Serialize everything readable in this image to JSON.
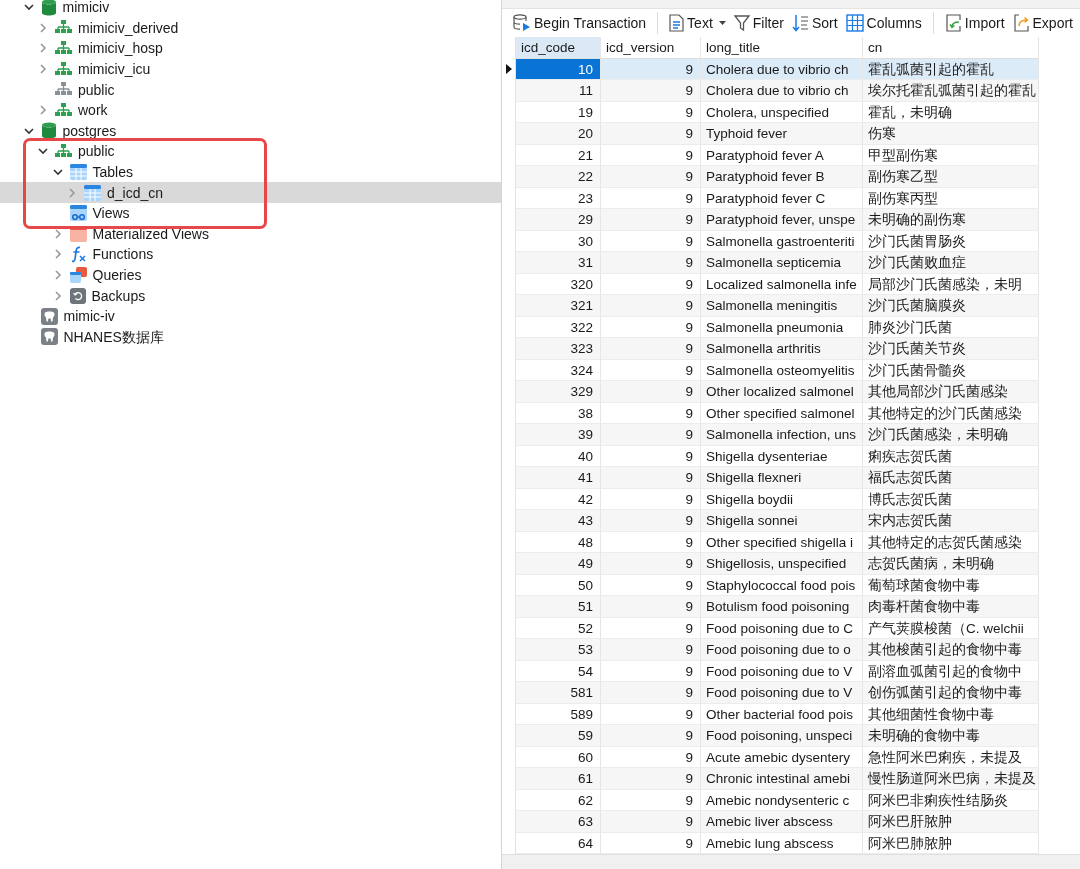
{
  "tree": [
    {
      "label": "mimiciv",
      "kind": "database",
      "expandable": true,
      "expanded": true,
      "selected": false,
      "children": [
        {
          "label": "mimiciv_derived",
          "kind": "schema",
          "expandable": true,
          "expanded": false,
          "selected": false
        },
        {
          "label": "mimiciv_hosp",
          "kind": "schema",
          "expandable": true,
          "expanded": false,
          "selected": false
        },
        {
          "label": "mimiciv_icu",
          "kind": "schema",
          "expandable": true,
          "expanded": false,
          "selected": false
        },
        {
          "label": "public",
          "kind": "schema_inactive",
          "expandable": false,
          "selected": false
        },
        {
          "label": "work",
          "kind": "schema",
          "expandable": true,
          "expanded": false,
          "selected": false
        }
      ]
    },
    {
      "label": "postgres",
      "kind": "database",
      "expandable": true,
      "expanded": true,
      "selected": false,
      "children": [
        {
          "label": "public",
          "kind": "schema",
          "expandable": true,
          "expanded": true,
          "selected": false,
          "children": [
            {
              "label": "Tables",
              "kind": "tables",
              "expandable": true,
              "expanded": true,
              "selected": false,
              "children": [
                {
                  "label": "d_icd_cn",
                  "kind": "table",
                  "expandable": true,
                  "expanded": false,
                  "selected": true
                }
              ]
            },
            {
              "label": "Views",
              "kind": "views",
              "expandable": false,
              "selected": false
            },
            {
              "label": "Materialized Views",
              "kind": "matviews",
              "expandable": true,
              "expanded": false,
              "selected": false
            },
            {
              "label": "Functions",
              "kind": "functions",
              "expandable": true,
              "expanded": false,
              "selected": false
            },
            {
              "label": "Queries",
              "kind": "queries",
              "expandable": true,
              "expanded": false,
              "selected": false
            },
            {
              "label": "Backups",
              "kind": "backups",
              "expandable": true,
              "expanded": false,
              "selected": false
            }
          ]
        }
      ]
    },
    {
      "label": "mimic-iv",
      "kind": "connection",
      "expandable": false,
      "selected": false
    },
    {
      "label": "NHANES数据库",
      "kind": "connection",
      "expandable": false,
      "selected": false
    }
  ],
  "annotation": {
    "kind": "frame"
  },
  "toolbar": {
    "groups": [
      [
        {
          "label": "Begin Transaction",
          "kind": "transaction",
          "dropdown": false
        }
      ],
      [
        {
          "label": "Text",
          "kind": "text",
          "dropdown": true
        },
        {
          "label": "Filter",
          "kind": "filter",
          "dropdown": false
        },
        {
          "label": "Sort",
          "kind": "sort",
          "dropdown": false
        },
        {
          "label": "Columns",
          "kind": "columns",
          "dropdown": false
        }
      ],
      [
        {
          "label": "Import",
          "kind": "import",
          "dropdown": false
        },
        {
          "label": "Export",
          "kind": "export",
          "dropdown": false
        }
      ]
    ]
  },
  "table": {
    "columns": [
      {
        "label": "icd_code",
        "kind": "number"
      },
      {
        "label": "icd_version",
        "kind": "number"
      },
      {
        "label": "long_title",
        "kind": "text"
      },
      {
        "label": "cn",
        "kind": "text"
      }
    ],
    "rows": [
      {
        "cells": [
          "10",
          "9",
          "Cholera due to vibrio ch",
          "霍乱弧菌引起的霍乱"
        ],
        "selected": true
      },
      {
        "cells": [
          "11",
          "9",
          "Cholera due to vibrio ch",
          "埃尔托霍乱弧菌引起的霍乱"
        ],
        "selected": false
      },
      {
        "cells": [
          "19",
          "9",
          "Cholera, unspecified",
          "霍乱，未明确"
        ],
        "selected": false
      },
      {
        "cells": [
          "20",
          "9",
          "Typhoid fever",
          "伤寒"
        ],
        "selected": false
      },
      {
        "cells": [
          "21",
          "9",
          "Paratyphoid fever A",
          "甲型副伤寒"
        ],
        "selected": false
      },
      {
        "cells": [
          "22",
          "9",
          "Paratyphoid fever B",
          "副伤寒乙型"
        ],
        "selected": false
      },
      {
        "cells": [
          "23",
          "9",
          "Paratyphoid fever C",
          "副伤寒丙型"
        ],
        "selected": false
      },
      {
        "cells": [
          "29",
          "9",
          "Paratyphoid fever, unspe",
          "未明确的副伤寒"
        ],
        "selected": false
      },
      {
        "cells": [
          "30",
          "9",
          "Salmonella gastroenteriti",
          "沙门氏菌胃肠炎"
        ],
        "selected": false
      },
      {
        "cells": [
          "31",
          "9",
          "Salmonella septicemia",
          "沙门氏菌败血症"
        ],
        "selected": false
      },
      {
        "cells": [
          "320",
          "9",
          "Localized salmonella infe",
          "局部沙门氏菌感染，未明"
        ],
        "selected": false
      },
      {
        "cells": [
          "321",
          "9",
          "Salmonella meningitis",
          "沙门氏菌脑膜炎"
        ],
        "selected": false
      },
      {
        "cells": [
          "322",
          "9",
          "Salmonella pneumonia",
          "肺炎沙门氏菌"
        ],
        "selected": false
      },
      {
        "cells": [
          "323",
          "9",
          "Salmonella arthritis",
          "沙门氏菌关节炎"
        ],
        "selected": false
      },
      {
        "cells": [
          "324",
          "9",
          "Salmonella osteomyelitis",
          "沙门氏菌骨髓炎"
        ],
        "selected": false
      },
      {
        "cells": [
          "329",
          "9",
          "Other localized salmonel",
          "其他局部沙门氏菌感染"
        ],
        "selected": false
      },
      {
        "cells": [
          "38",
          "9",
          "Other specified salmonel",
          "其他特定的沙门氏菌感染"
        ],
        "selected": false
      },
      {
        "cells": [
          "39",
          "9",
          "Salmonella infection, uns",
          "沙门氏菌感染，未明确"
        ],
        "selected": false
      },
      {
        "cells": [
          "40",
          "9",
          "Shigella dysenteriae",
          "痢疾志贺氏菌"
        ],
        "selected": false
      },
      {
        "cells": [
          "41",
          "9",
          "Shigella flexneri",
          "福氏志贺氏菌"
        ],
        "selected": false
      },
      {
        "cells": [
          "42",
          "9",
          "Shigella boydii",
          "博氏志贺氏菌"
        ],
        "selected": false
      },
      {
        "cells": [
          "43",
          "9",
          "Shigella sonnei",
          "宋内志贺氏菌"
        ],
        "selected": false
      },
      {
        "cells": [
          "48",
          "9",
          "Other specified shigella i",
          "其他特定的志贺氏菌感染"
        ],
        "selected": false
      },
      {
        "cells": [
          "49",
          "9",
          "Shigellosis, unspecified",
          "志贺氏菌病，未明确"
        ],
        "selected": false
      },
      {
        "cells": [
          "50",
          "9",
          "Staphylococcal food pois",
          "葡萄球菌食物中毒"
        ],
        "selected": false
      },
      {
        "cells": [
          "51",
          "9",
          "Botulism food poisoning",
          "肉毒杆菌食物中毒"
        ],
        "selected": false
      },
      {
        "cells": [
          "52",
          "9",
          "Food poisoning due to C",
          "产气荚膜梭菌（C. welchii"
        ],
        "selected": false
      },
      {
        "cells": [
          "53",
          "9",
          "Food poisoning due to o",
          "其他梭菌引起的食物中毒"
        ],
        "selected": false
      },
      {
        "cells": [
          "54",
          "9",
          "Food poisoning due to V",
          "副溶血弧菌引起的食物中"
        ],
        "selected": false
      },
      {
        "cells": [
          "581",
          "9",
          "Food poisoning due to V",
          "创伤弧菌引起的食物中毒"
        ],
        "selected": false
      },
      {
        "cells": [
          "589",
          "9",
          "Other bacterial food pois",
          "其他细菌性食物中毒"
        ],
        "selected": false
      },
      {
        "cells": [
          "59",
          "9",
          "Food poisoning, unspeci",
          "未明确的食物中毒"
        ],
        "selected": false
      },
      {
        "cells": [
          "60",
          "9",
          "Acute amebic dysentery",
          "急性阿米巴痢疾，未提及"
        ],
        "selected": false
      },
      {
        "cells": [
          "61",
          "9",
          "Chronic intestinal amebi",
          "慢性肠道阿米巴病，未提及"
        ],
        "selected": false
      },
      {
        "cells": [
          "62",
          "9",
          "Amebic nondysenteric c",
          "阿米巴非痢疾性结肠炎"
        ],
        "selected": false
      },
      {
        "cells": [
          "63",
          "9",
          "Amebic liver abscess",
          "阿米巴肝脓肿"
        ],
        "selected": false
      },
      {
        "cells": [
          "64",
          "9",
          "Amebic lung abscess",
          "阿米巴肺脓肿"
        ],
        "selected": false
      }
    ]
  }
}
